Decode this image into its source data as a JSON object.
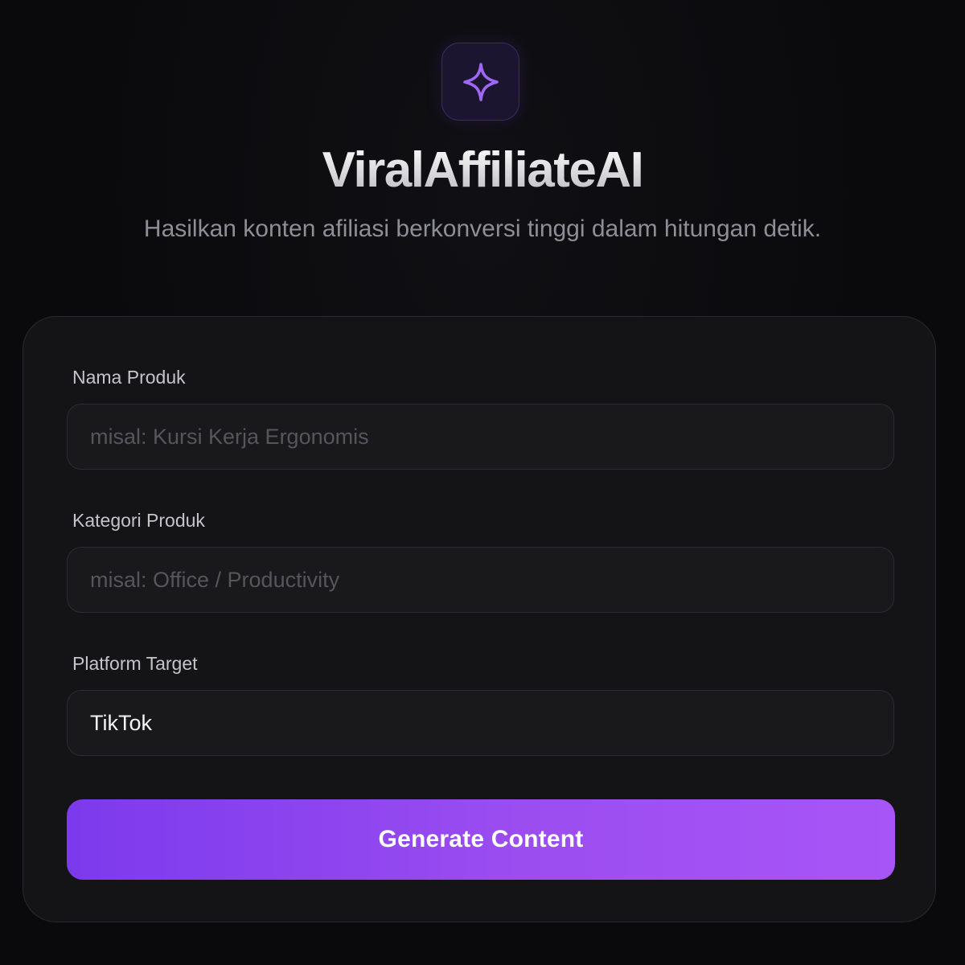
{
  "app": {
    "title": "ViralAffiliateAI",
    "subtitle": "Hasilkan konten afiliasi berkonversi tinggi dalam hitungan detik.",
    "logo_icon": "sparkle-icon",
    "accent_color": "#a855f7"
  },
  "form": {
    "product_name": {
      "label": "Nama Produk",
      "placeholder": "misal: Kursi Kerja Ergonomis",
      "value": ""
    },
    "product_category": {
      "label": "Kategori Produk",
      "placeholder": "misal: Office / Productivity",
      "value": ""
    },
    "target_platform": {
      "label": "Platform Target",
      "value": "TikTok"
    },
    "submit_label": "Generate Content"
  },
  "colors": {
    "background": "#0a0a0c",
    "card": "#141416",
    "button_gradient_start": "#7c3aed",
    "button_gradient_end": "#a855f7"
  }
}
